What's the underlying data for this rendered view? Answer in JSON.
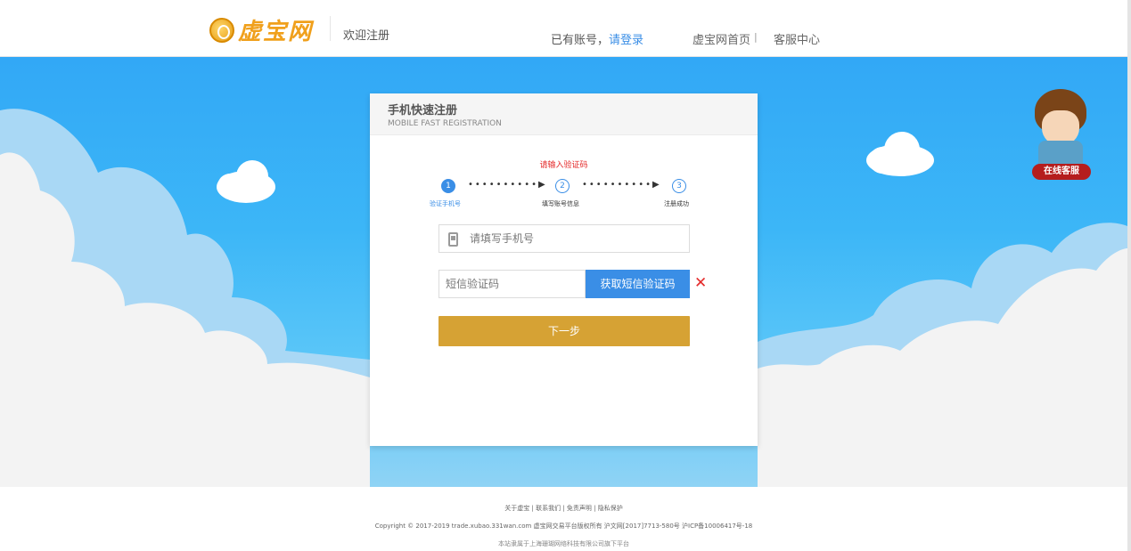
{
  "header": {
    "logo_text": "虚宝网",
    "welcome": "欢迎注册",
    "has_account": "已有账号，",
    "login_link": "请登录",
    "nav_home": "虚宝网首页",
    "nav_sep": "|",
    "nav_service": "客服中心"
  },
  "card": {
    "title": "手机快速注册",
    "subtitle": "MOBILE FAST REGISTRATION",
    "error": "请输入验证码",
    "steps": [
      {
        "num": "1",
        "label": "验证手机号"
      },
      {
        "num": "2",
        "label": "填写账号信息"
      },
      {
        "num": "3",
        "label": "注册成功"
      }
    ],
    "dots": "••••••••••▶",
    "phone_placeholder": "请填写手机号",
    "sms_placeholder": "短信验证码",
    "get_code": "获取短信验证码",
    "error_icon": "✕",
    "next": "下一步"
  },
  "cs": {
    "label": "在线客服"
  },
  "footer": {
    "links": "关于虚宝 | 联系我们 | 免责声明 | 隐私保护",
    "copyright": "Copyright © 2017-2019 trade.xubao.331wan.com 虚宝网交易平台版权所有 沪文网[2017]7713-580号 沪ICP备10006417号-18",
    "owner": "本站隶属于上海珊瑚网络科技有限公司旗下平台"
  },
  "colors": {
    "accent": "#3a8ee6",
    "next_button": "#d6a234",
    "error": "#e42a2a",
    "sky": "#3cb6f7"
  }
}
